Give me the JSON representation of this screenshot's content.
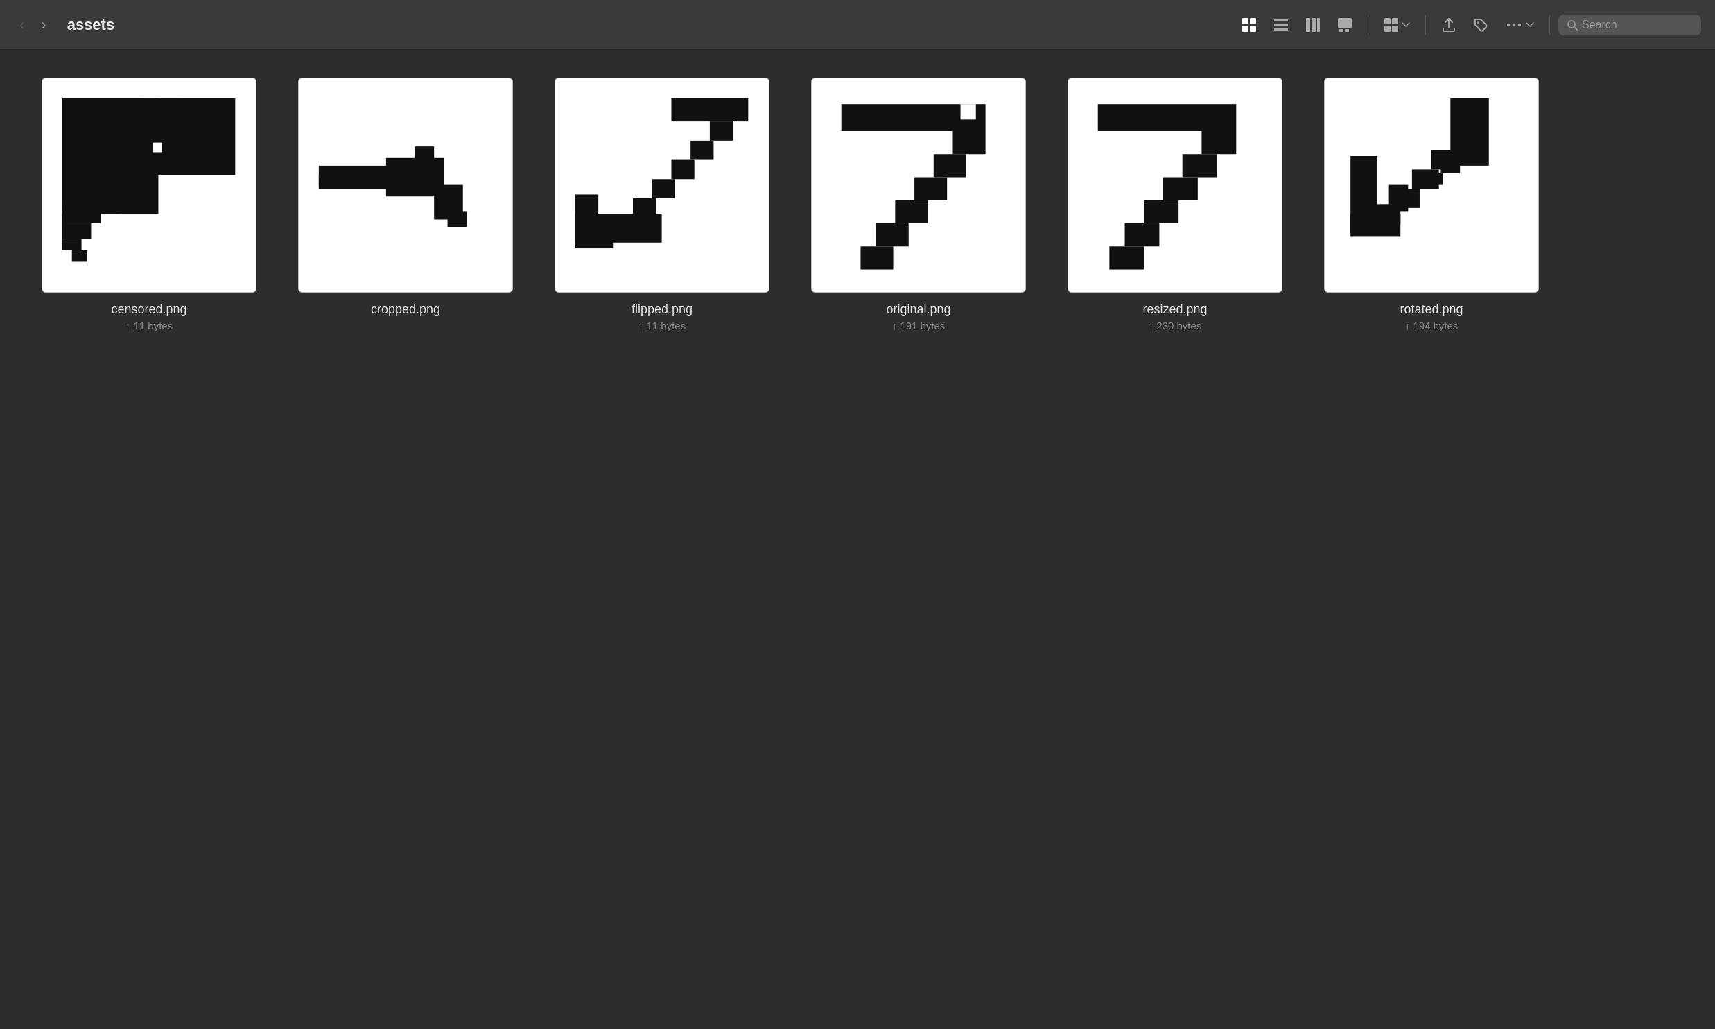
{
  "toolbar": {
    "title": "assets",
    "back_disabled": true,
    "forward_disabled": false,
    "search_placeholder": "Search",
    "view_icons": [
      "grid4",
      "list",
      "columns",
      "gallery",
      "grid_dropdown"
    ],
    "action_icons": [
      "share",
      "tag",
      "more"
    ]
  },
  "files": [
    {
      "id": "censored",
      "name": "censored.png",
      "size": "11 bytes",
      "shape": "censored"
    },
    {
      "id": "cropped",
      "name": "cropped.png",
      "size": null,
      "shape": "cropped"
    },
    {
      "id": "flipped",
      "name": "flipped.png",
      "size": "11 bytes",
      "shape": "flipped"
    },
    {
      "id": "original",
      "name": "original.png",
      "size": "191 bytes",
      "shape": "original"
    },
    {
      "id": "resized",
      "name": "resized.png",
      "size": "230 bytes",
      "shape": "resized"
    },
    {
      "id": "rotated",
      "name": "rotated.png",
      "size": "194 bytes",
      "shape": "rotated"
    }
  ]
}
